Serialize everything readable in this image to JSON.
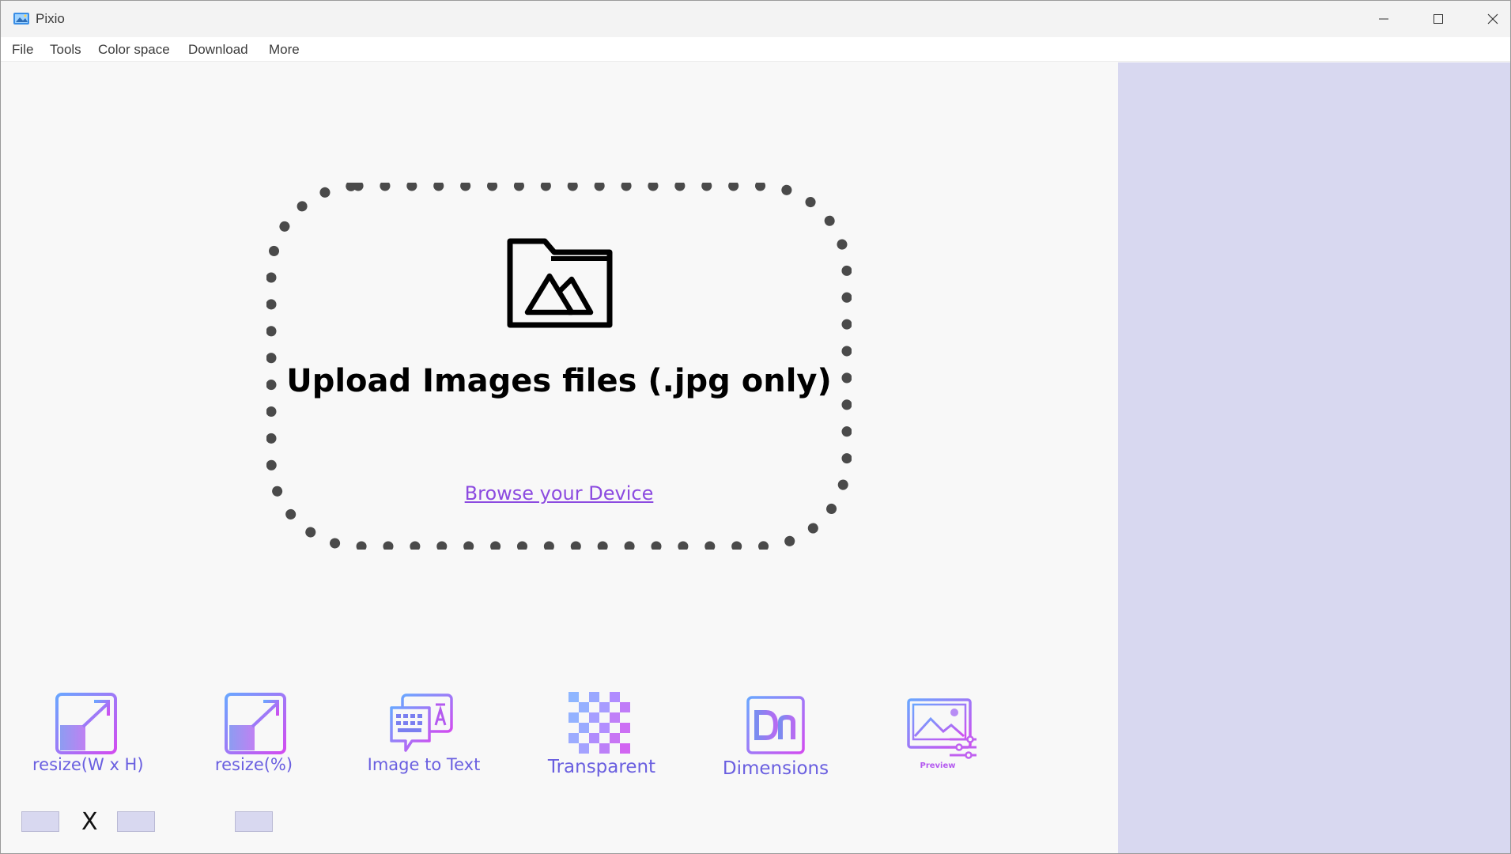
{
  "window": {
    "title": "Pixio"
  },
  "menu": {
    "items": [
      "File",
      "Tools",
      "Color space",
      "Download",
      "More"
    ]
  },
  "upload": {
    "title": "Upload Images files (.jpg only)",
    "browse_label": "Browse your Device"
  },
  "tools": [
    {
      "label": "resize(W x H)",
      "icon": "resize-wh-icon"
    },
    {
      "label": "resize(%)",
      "icon": "resize-percent-icon"
    },
    {
      "label": "Image to Text",
      "icon": "image-to-text-icon"
    },
    {
      "label": "Transparent",
      "icon": "transparent-icon"
    },
    {
      "label": "Dimensions",
      "icon": "dimensions-icon"
    },
    {
      "label": "Preview",
      "icon": "preview-icon"
    }
  ],
  "resize_inputs": {
    "separator": "X",
    "width_value": "",
    "height_value": "",
    "percent_value": ""
  },
  "colors": {
    "accent_purple": "#8c4be0",
    "gradient_start": "#6aa6ff",
    "gradient_end": "#d24cf0",
    "sidebar": "#d8d8f0"
  }
}
